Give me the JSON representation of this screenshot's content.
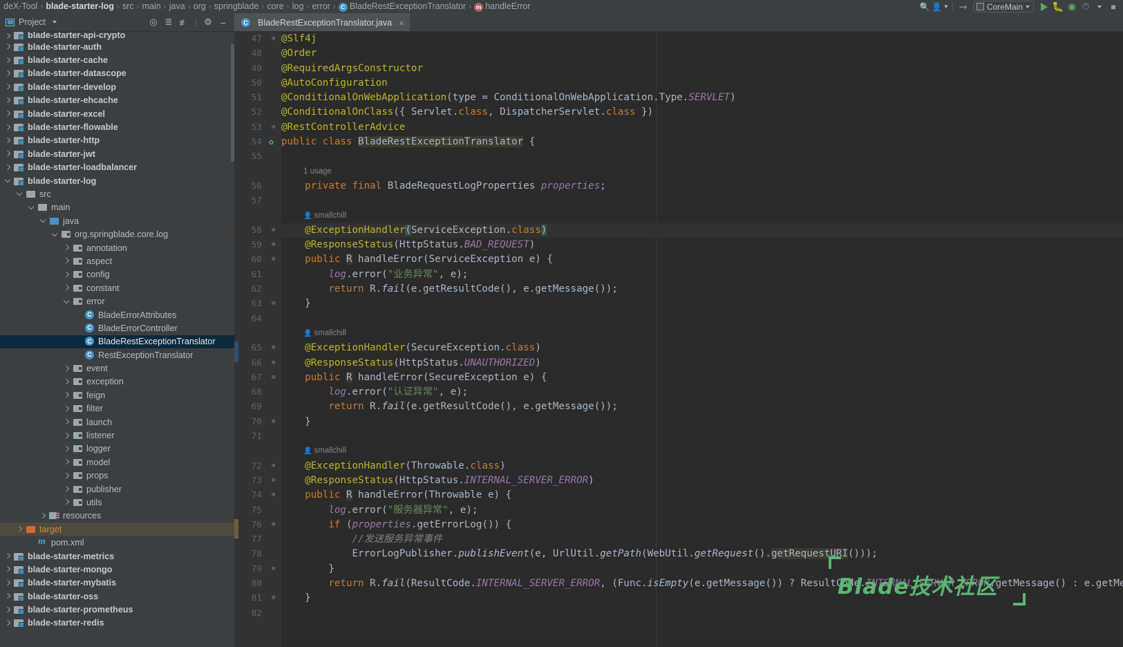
{
  "navbar": {
    "crumbs": [
      {
        "label": "deX-Tool",
        "bold": false,
        "icon": null
      },
      {
        "label": "blade-starter-log",
        "bold": true,
        "icon": null
      },
      {
        "label": "src",
        "bold": false,
        "icon": null
      },
      {
        "label": "main",
        "bold": false,
        "icon": null
      },
      {
        "label": "java",
        "bold": false,
        "icon": null
      },
      {
        "label": "org",
        "bold": false,
        "icon": null
      },
      {
        "label": "springblade",
        "bold": false,
        "icon": null
      },
      {
        "label": "core",
        "bold": false,
        "icon": null
      },
      {
        "label": "log",
        "bold": false,
        "icon": null
      },
      {
        "label": "error",
        "bold": false,
        "icon": null
      },
      {
        "label": "BladeRestExceptionTranslator",
        "bold": false,
        "icon": "class-icon"
      },
      {
        "label": "handleError",
        "bold": false,
        "icon": "method-icon"
      }
    ],
    "separator": "›",
    "run_config": "CoreMain",
    "icons": {
      "user": "user-icon",
      "updates": "updates-icon",
      "run": "run-icon",
      "debug": "debug-icon",
      "run_coverage": "run-with-coverage-icon",
      "profile": "profiler-icon",
      "stop": "stop-icon",
      "search": "search-icon"
    }
  },
  "project_panel": {
    "title": "Project",
    "icons": {
      "window": "project-window-icon",
      "dropdown": "chevron-down-icon",
      "locate": "scroll-from-source-icon",
      "expand": "expand-all-icon",
      "collapse": "collapse-all-icon",
      "settings": "gear-icon",
      "hide": "hide-panel-icon"
    },
    "tree": [
      {
        "label": "blade-starter-api-crypto",
        "depth": 0,
        "arrow": "right",
        "icon": "module",
        "style": "bold",
        "cut": true
      },
      {
        "label": "blade-starter-auth",
        "depth": 0,
        "arrow": "right",
        "icon": "module",
        "style": "bold"
      },
      {
        "label": "blade-starter-cache",
        "depth": 0,
        "arrow": "right",
        "icon": "module",
        "style": "bold"
      },
      {
        "label": "blade-starter-datascope",
        "depth": 0,
        "arrow": "right",
        "icon": "module",
        "style": "bold"
      },
      {
        "label": "blade-starter-develop",
        "depth": 0,
        "arrow": "right",
        "icon": "module",
        "style": "bold"
      },
      {
        "label": "blade-starter-ehcache",
        "depth": 0,
        "arrow": "right",
        "icon": "module",
        "style": "bold"
      },
      {
        "label": "blade-starter-excel",
        "depth": 0,
        "arrow": "right",
        "icon": "module",
        "style": "bold"
      },
      {
        "label": "blade-starter-flowable",
        "depth": 0,
        "arrow": "right",
        "icon": "module",
        "style": "bold"
      },
      {
        "label": "blade-starter-http",
        "depth": 0,
        "arrow": "right",
        "icon": "module",
        "style": "bold"
      },
      {
        "label": "blade-starter-jwt",
        "depth": 0,
        "arrow": "right",
        "icon": "module",
        "style": "bold"
      },
      {
        "label": "blade-starter-loadbalancer",
        "depth": 0,
        "arrow": "right",
        "icon": "module",
        "style": "bold"
      },
      {
        "label": "blade-starter-log",
        "depth": 0,
        "arrow": "down",
        "icon": "module",
        "style": "bold"
      },
      {
        "label": "src",
        "depth": 1,
        "arrow": "down",
        "icon": "folder"
      },
      {
        "label": "main",
        "depth": 2,
        "arrow": "down",
        "icon": "folder"
      },
      {
        "label": "java",
        "depth": 3,
        "arrow": "down",
        "icon": "srcroot"
      },
      {
        "label": "org.springblade.core.log",
        "depth": 4,
        "arrow": "down",
        "icon": "package"
      },
      {
        "label": "annotation",
        "depth": 5,
        "arrow": "right",
        "icon": "package"
      },
      {
        "label": "aspect",
        "depth": 5,
        "arrow": "right",
        "icon": "package"
      },
      {
        "label": "config",
        "depth": 5,
        "arrow": "right",
        "icon": "package"
      },
      {
        "label": "constant",
        "depth": 5,
        "arrow": "right",
        "icon": "package"
      },
      {
        "label": "error",
        "depth": 5,
        "arrow": "down",
        "icon": "package"
      },
      {
        "label": "BladeErrorAttributes",
        "depth": 6,
        "arrow": "none",
        "icon": "class"
      },
      {
        "label": "BladeErrorController",
        "depth": 6,
        "arrow": "none",
        "icon": "class"
      },
      {
        "label": "BladeRestExceptionTranslator",
        "depth": 6,
        "arrow": "none",
        "icon": "class",
        "state": "selected"
      },
      {
        "label": "RestExceptionTranslator",
        "depth": 6,
        "arrow": "none",
        "icon": "class"
      },
      {
        "label": "event",
        "depth": 5,
        "arrow": "right",
        "icon": "package"
      },
      {
        "label": "exception",
        "depth": 5,
        "arrow": "right",
        "icon": "package"
      },
      {
        "label": "feign",
        "depth": 5,
        "arrow": "right",
        "icon": "package"
      },
      {
        "label": "filter",
        "depth": 5,
        "arrow": "right",
        "icon": "package"
      },
      {
        "label": "launch",
        "depth": 5,
        "arrow": "right",
        "icon": "package"
      },
      {
        "label": "listener",
        "depth": 5,
        "arrow": "right",
        "icon": "package"
      },
      {
        "label": "logger",
        "depth": 5,
        "arrow": "right",
        "icon": "package"
      },
      {
        "label": "model",
        "depth": 5,
        "arrow": "right",
        "icon": "package"
      },
      {
        "label": "props",
        "depth": 5,
        "arrow": "right",
        "icon": "package"
      },
      {
        "label": "publisher",
        "depth": 5,
        "arrow": "right",
        "icon": "package"
      },
      {
        "label": "utils",
        "depth": 5,
        "arrow": "right",
        "icon": "package"
      },
      {
        "label": "resources",
        "depth": 3,
        "arrow": "right",
        "icon": "resources"
      },
      {
        "label": "target",
        "depth": 1,
        "arrow": "right",
        "icon": "target",
        "state": "hover",
        "style": "orange"
      },
      {
        "label": "pom.xml",
        "depth": 2,
        "arrow": "none",
        "icon": "maven"
      },
      {
        "label": "blade-starter-metrics",
        "depth": 0,
        "arrow": "right",
        "icon": "module",
        "style": "bold"
      },
      {
        "label": "blade-starter-mongo",
        "depth": 0,
        "arrow": "right",
        "icon": "module",
        "style": "bold"
      },
      {
        "label": "blade-starter-mybatis",
        "depth": 0,
        "arrow": "right",
        "icon": "module",
        "style": "bold"
      },
      {
        "label": "blade-starter-oss",
        "depth": 0,
        "arrow": "right",
        "icon": "module",
        "style": "bold"
      },
      {
        "label": "blade-starter-prometheus",
        "depth": 0,
        "arrow": "right",
        "icon": "module",
        "style": "bold"
      },
      {
        "label": "blade-starter-redis",
        "depth": 0,
        "arrow": "right",
        "icon": "module",
        "style": "bold"
      }
    ]
  },
  "editor": {
    "tab": {
      "label": "BladeRestExceptionTranslator.java",
      "icon": "class-icon",
      "close": "×"
    },
    "watermark": "Blade技术社区",
    "inlay_author": "smallchill",
    "inlay_usage": "1 usage",
    "lines": [
      {
        "n": 47,
        "fold": "⊖",
        "html": "<span class='ann'>@Slf4j</span>"
      },
      {
        "n": 48,
        "html": "<span class='ann'>@Order</span>"
      },
      {
        "n": 49,
        "html": "<span class='ann'>@RequiredArgsConstructor</span>"
      },
      {
        "n": 50,
        "html": "<span class='ann'>@AutoConfiguration</span>"
      },
      {
        "n": 51,
        "html": "<span class='ann'>@ConditionalOnWebApplication</span>(type = ConditionalOnWebApplication.Type.<span class='fld'>SERVLET</span>)"
      },
      {
        "n": 52,
        "html": "<span class='ann'>@ConditionalOnClass</span>({ Servlet.<span class='kw'>class</span>, DispatcherServlet.<span class='kw'>class</span> })"
      },
      {
        "n": 53,
        "fold": "⊖",
        "html": "<span class='ann'>@RestControllerAdvice</span>"
      },
      {
        "n": 54,
        "bean": true,
        "html": "<span class='kw'>public class</span> <span class='hlid'>BladeRestExceptionTranslator</span> {"
      },
      {
        "n": 55,
        "html": ""
      },
      {
        "inlay": "usage"
      },
      {
        "n": 56,
        "html": "    <span class='kw'>private final</span> BladeRequestLogProperties <span class='fld'>properties</span>;"
      },
      {
        "n": 57,
        "html": ""
      },
      {
        "inlay": "author"
      },
      {
        "n": 58,
        "fold": "⊖",
        "hl": true,
        "html": "    <span class='ann'>@ExceptionHandler</span><span class='hlbr'>(</span>ServiceException.<span class='kw'>class</span><span class='hlbr'>)</span>"
      },
      {
        "n": 59,
        "fold": "⊖",
        "html": "    <span class='ann'>@ResponseStatus</span>(HttpStatus.<span class='fld'>BAD_REQUEST</span>)"
      },
      {
        "n": 60,
        "fold": "⊖",
        "html": "    <span class='kw'>public</span> <span class='hlid'>R</span> handleError(ServiceException e) {"
      },
      {
        "n": 61,
        "html": "        <span class='log'>log</span>.error(<span class='str'>\"业务异常\"</span>, e);"
      },
      {
        "n": 62,
        "html": "        <span class='kw'>return</span> R.<span class='mth'>fail</span>(e.getResultCode(), e.getMessage());"
      },
      {
        "n": 63,
        "fold": "⊖",
        "html": "    }"
      },
      {
        "n": 64,
        "html": ""
      },
      {
        "inlay": "author"
      },
      {
        "n": 65,
        "fold": "⊖",
        "html": "    <span class='ann'>@ExceptionHandler</span>(SecureException.<span class='kw'>class</span>)"
      },
      {
        "n": 66,
        "fold": "⊖",
        "html": "    <span class='ann'>@ResponseStatus</span>(HttpStatus.<span class='fld'>UNAUTHORIZED</span>)"
      },
      {
        "n": 67,
        "fold": "⊖",
        "html": "    <span class='kw'>public</span> <span class='hlid'>R</span> handleError(SecureException e) {"
      },
      {
        "n": 68,
        "html": "        <span class='log'>log</span>.error(<span class='str'>\"认证异常\"</span>, e);"
      },
      {
        "n": 69,
        "html": "        <span class='kw'>return</span> R.<span class='mth'>fail</span>(e.getResultCode(), e.getMessage());"
      },
      {
        "n": 70,
        "fold": "⊖",
        "html": "    }"
      },
      {
        "n": 71,
        "html": ""
      },
      {
        "inlay": "author"
      },
      {
        "n": 72,
        "fold": "⊖",
        "html": "    <span class='ann'>@ExceptionHandler</span>(Throwable.<span class='kw'>class</span>)"
      },
      {
        "n": 73,
        "fold": "⊖",
        "html": "    <span class='ann'>@ResponseStatus</span>(HttpStatus.<span class='fld'>INTERNAL_SERVER_ERROR</span>)"
      },
      {
        "n": 74,
        "fold": "⊖",
        "html": "    <span class='kw'>public</span> <span class='hlid'>R</span> handleError(Throwable e) {"
      },
      {
        "n": 75,
        "html": "        <span class='log'>log</span>.error(<span class='str'>\"服务器异常\"</span>, e);"
      },
      {
        "n": 76,
        "fold": "⊖",
        "html": "        <span class='kw'>if</span> (<span class='fld'>properties</span>.getErrorLog()) {"
      },
      {
        "n": 77,
        "html": "            <span class='cmt'>//发送服务异常事件</span>"
      },
      {
        "n": 78,
        "html": "            ErrorLogPublisher.<span class='mth'>publishEvent</span>(e, UrlUtil.<span class='mth'>getPath</span>(WebUtil.<span class='mth'>getRequest</span>().<span class='hlid'>getRequestURI</span>()));"
      },
      {
        "n": 79,
        "fold": "⊖",
        "html": "        }"
      },
      {
        "n": 80,
        "html": "        <span class='kw'>return</span> R.<span class='mth'>fail</span>(ResultCode.<span class='fld'>INTERNAL_SERVER_ERROR</span>, (Func.<span class='mth'>isEmpty</span>(e.getMessage()) ? ResultCode.<span class='fld'>INTERNAL_SERVER_ERROR</span>.getMessage() : e.getMessage()))"
      },
      {
        "n": 81,
        "fold": "⊖",
        "html": "    }"
      },
      {
        "n": 82,
        "html": ""
      }
    ]
  },
  "colors": {
    "panel_bg": "#3c3f41",
    "editor_bg": "#2b2b2b",
    "gutter_bg": "#313335",
    "selection": "#0d293e",
    "hover": "#4e4a3d",
    "annotation": "#bbb529",
    "keyword": "#cc7832",
    "string": "#6a8759",
    "field": "#9876aa",
    "comment": "#808080",
    "accent_green": "#5cb574",
    "class_icon": "#4593c7",
    "target_orange": "#cf6a35"
  }
}
